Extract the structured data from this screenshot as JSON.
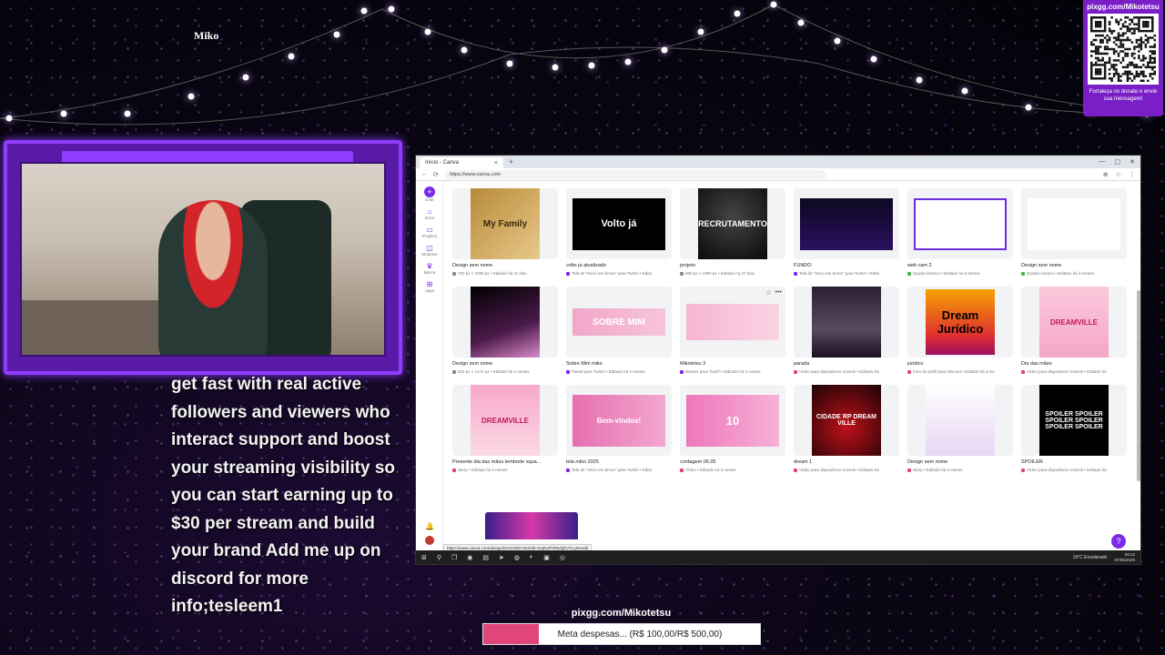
{
  "overlay": {
    "streamer_name": "Miko",
    "qr": {
      "url": "pixgg.com/Mikotetsu",
      "caption": "Fortaleça no donate e envie sua mensagem!"
    },
    "chat_message": "get fast with real active followers and viewers who interact support and boost your streaming visibility so you can start earning up to $30 per stream and build your brand Add me up on discord for more info;tesleem1",
    "goal": {
      "url": "pixgg.com/Mikotetsu",
      "label": "Meta despesas... (R$ 100,00/R$ 500,00)",
      "progress_fraction": 0.2,
      "color": "#e0457c"
    }
  },
  "browser": {
    "tab_title": "Início - Canva",
    "tab_close": "×",
    "new_tab": "+",
    "window_controls": {
      "minimize": "—",
      "maximize": "▢",
      "close": "✕"
    },
    "nav": {
      "back": "←",
      "reload": "⟳"
    },
    "address": "https://www.canva.com",
    "status_url": "https://www.canva.com/design/DAGmtbtY4K/edit-vzqRuFhRNdQh7XcyNAedit",
    "addr_icons": {
      "extensions": "⊕",
      "star": "☆",
      "menu": "⋮"
    }
  },
  "canva": {
    "sidebar": [
      {
        "label": "Criar",
        "icon": "plus-icon",
        "glyph": "+"
      },
      {
        "label": "Início",
        "icon": "home-icon",
        "glyph": "⌂"
      },
      {
        "label": "Projetos",
        "icon": "folder-icon",
        "glyph": "▭"
      },
      {
        "label": "Modelos",
        "icon": "templates-icon",
        "glyph": "◫"
      },
      {
        "label": "Marca",
        "icon": "brand-icon",
        "glyph": "♛"
      },
      {
        "label": "Apps",
        "icon": "apps-icon",
        "glyph": "⊞"
      }
    ],
    "bell_glyph": "🔔",
    "help_glyph": "?",
    "card_actions": {
      "star": "☆",
      "more": "•••"
    },
    "designs": [
      {
        "title": "Design sem nome",
        "meta": "720 px × 1080 px • Editado há 11 dias",
        "dot": "#8a8a8a",
        "thumb_text": "My Family",
        "w": 76,
        "h": 78,
        "bg": "linear-gradient(135deg,#b88a3a,#e8c98a)",
        "fg": "#3a2a10",
        "fs": 10
      },
      {
        "title": "volto ja atualizado",
        "meta": "Tela de \"Inicio em breve\" para Twitch • Edita",
        "dot": "#7d2ae8",
        "thumb_text": "Volto já",
        "w": 102,
        "h": 57,
        "bg": "#000",
        "fg": "#fff",
        "fs": 11
      },
      {
        "title": "projeto",
        "meta": "960 px × 1080 px • Editado há 27 dias",
        "dot": "#8a8a8a",
        "thumb_text": "RECRUTAMENTO",
        "w": 76,
        "h": 78,
        "bg": "radial-gradient(circle at 50% 40%,#444,#0a0a0a)",
        "fg": "#fff",
        "fs": 9
      },
      {
        "title": "FUNDO",
        "meta": "Tela de \"Inicio em breve\" para Twitch • Edita",
        "dot": "#7d2ae8",
        "thumb_text": "",
        "w": 102,
        "h": 57,
        "bg": "linear-gradient(180deg,#0d0820,#2a1060)",
        "fg": "#fff",
        "fs": 8
      },
      {
        "title": "web cam 2",
        "meta": "Quadro branco • Editado há 3 meses",
        "dot": "#3bb54a",
        "thumb_text": "",
        "w": 102,
        "h": 57,
        "bg": "#fff",
        "fg": "#6a2ee0",
        "fs": 8,
        "border": "2px solid #6a2ee0"
      },
      {
        "title": "Design sem nome",
        "meta": "Quadro branco • Editado há 3 meses",
        "dot": "#3bb54a",
        "thumb_text": "",
        "w": 102,
        "h": 57,
        "bg": "#fff",
        "fg": "#000",
        "fs": 8
      },
      {
        "title": "Design sem nome",
        "meta": "832 px × 1472 px • Editado há 2 meses",
        "dot": "#8a8a8a",
        "thumb_text": "",
        "w": 76,
        "h": 78,
        "bg": "linear-gradient(160deg,#000,#4a1a4a 60%,#d98ac8)",
        "fg": "#fff",
        "fs": 8
      },
      {
        "title": "Sobre Mim miko",
        "meta": "Painel para Twitch • Editado há 2 meses",
        "dot": "#7d2ae8",
        "thumb_text": "SOBRE MIM",
        "w": 102,
        "h": 30,
        "bg": "linear-gradient(90deg,#f1a6c8,#f7c4dc)",
        "fg": "#fff",
        "fs": 10
      },
      {
        "title": "Mikotetsu 3",
        "meta": "Banner para Twitch • Editado há 2 meses",
        "dot": "#7d2ae8",
        "thumb_text": "",
        "w": 102,
        "h": 40,
        "bg": "linear-gradient(90deg,#f5b6d0,#fbd3e3)",
        "fg": "#333",
        "fs": 6,
        "actions": true
      },
      {
        "title": "parada",
        "meta": "Vídeo para dispositivos móveis • Editado há",
        "dot": "#e0457c",
        "thumb_text": "",
        "w": 76,
        "h": 78,
        "bg": "linear-gradient(180deg,#2a2030,#5a4a60 60%,#1a1020)",
        "fg": "#fff",
        "fs": 8
      },
      {
        "title": "juridico",
        "meta": "Foto de perfil para Discord • Editado há 3 me",
        "dot": "#e0457c",
        "thumb_text": "Dream Jurídico",
        "w": 76,
        "h": 72,
        "bg": "linear-gradient(180deg,#f5a300,#e03030 70%,#a01060)",
        "fg": "#000",
        "fs": 13
      },
      {
        "title": "Dia das mães",
        "meta": "Vídeo para dispositivos móveis • Editado há",
        "dot": "#e0457c",
        "thumb_text": "DREAMVILLE",
        "w": 76,
        "h": 78,
        "bg": "linear-gradient(180deg,#fbc9dc,#f4a6c6)",
        "fg": "#c0185a",
        "fs": 8
      },
      {
        "title": "Presente dia das mães lembrete squa...",
        "meta": "Story • Editado há 3 meses",
        "dot": "#e0457c",
        "thumb_text": "DREAMVILLE",
        "w": 76,
        "h": 78,
        "bg": "linear-gradient(180deg,#f7a9c9,#fcd9e6)",
        "fg": "#c0185a",
        "fs": 8
      },
      {
        "title": "tela miko 2025",
        "meta": "Tela de \"Inicio em breve\" para Twitch • Edita",
        "dot": "#7d2ae8",
        "thumb_text": "Bem-vindos!",
        "w": 102,
        "h": 57,
        "bg": "linear-gradient(90deg,#e66fb0,#f3a7cf)",
        "fg": "#fff",
        "fs": 8
      },
      {
        "title": "contagem 06.05",
        "meta": "Vídeo • Editado há 3 meses",
        "dot": "#e0457c",
        "thumb_text": "10",
        "w": 102,
        "h": 57,
        "bg": "linear-gradient(90deg,#ee77bb,#f6b1d6)",
        "fg": "#fff",
        "fs": 13
      },
      {
        "title": "dream 1",
        "meta": "Vídeo para dispositivos móveis • Editado há",
        "dot": "#e0457c",
        "thumb_text": "CIDADE RP DREAM VILLE",
        "w": 76,
        "h": 78,
        "bg": "radial-gradient(circle at 50% 60%,#c0101a,#1a0405)",
        "fg": "#fff",
        "fs": 7
      },
      {
        "title": "Design sem nome",
        "meta": "Story • Editado há 3 meses",
        "dot": "#e0457c",
        "thumb_text": "",
        "w": 76,
        "h": 78,
        "bg": "linear-gradient(180deg,#fff,#e8d6f4)",
        "fg": "#6a2ee0",
        "fs": 6
      },
      {
        "title": "SPOILER",
        "meta": "Vídeo para dispositivos móveis • Editado há",
        "dot": "#e0457c",
        "thumb_text": "SPOILER SPOILER SPOILER SPOILER SPOILER SPOILER",
        "w": 76,
        "h": 78,
        "bg": "#000",
        "fg": "#fff",
        "fs": 7
      }
    ]
  },
  "taskbar": {
    "icons": [
      "⊞",
      "⚲",
      "❐",
      "◉",
      "▤",
      "➤",
      "◍",
      "◐",
      "▣",
      "◎"
    ],
    "weather": "19°C  Ensolarado",
    "time": "09:12",
    "date": "07/05/2025"
  },
  "colors": {
    "accent": "#7d2ae8",
    "frame": "#8f3cff"
  }
}
